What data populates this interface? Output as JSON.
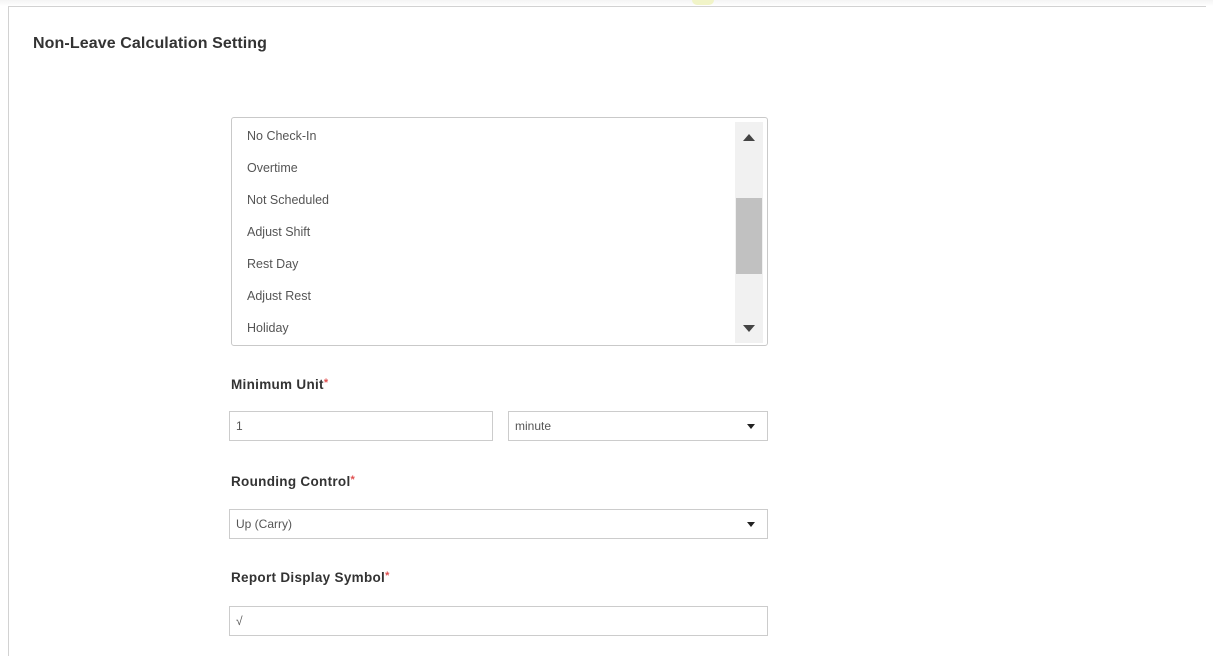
{
  "section": {
    "title": "Non-Leave Calculation Setting"
  },
  "exception_list": {
    "items": [
      "No Check-In",
      "Overtime",
      "Not Scheduled",
      "Adjust Shift",
      "Rest Day",
      "Adjust Rest",
      "Holiday"
    ]
  },
  "minimum_unit": {
    "label": "Minimum Unit",
    "required_mark": "*",
    "value": "1",
    "unit_selected": "minute"
  },
  "rounding_control": {
    "label": "Rounding Control",
    "required_mark": "*",
    "selected": "Up (Carry)"
  },
  "report_display_symbol": {
    "label": "Report Display Symbol",
    "required_mark": "*",
    "value": "√"
  },
  "icons": {
    "scroll_up": "triangle-up-icon",
    "scroll_down": "triangle-down-icon",
    "select_caret": "caret-down-icon"
  },
  "colors": {
    "required": "#e05050",
    "scroll_thumb": "#c1c1c1",
    "border": "#cccccc"
  }
}
